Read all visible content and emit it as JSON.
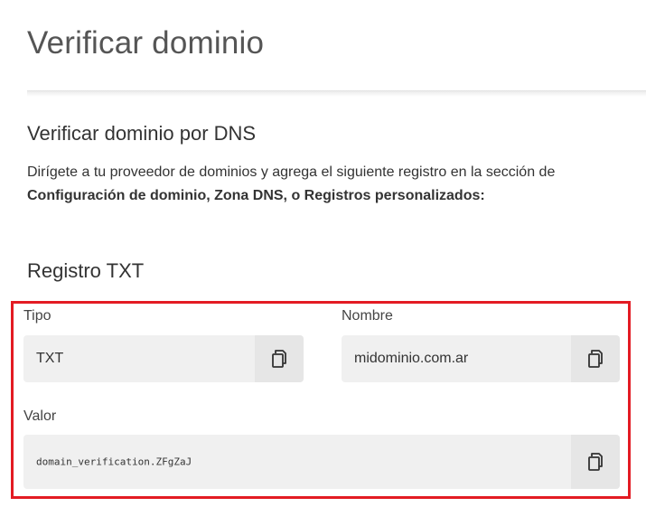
{
  "page": {
    "title": "Verificar dominio"
  },
  "dns_section": {
    "title": "Verificar dominio por DNS",
    "instructions_prefix": "Dirígete a tu proveedor de dominios y agrega el siguiente registro en la sección de ",
    "instructions_bold": "Configuración de dominio, Zona DNS, o Registros personalizados:"
  },
  "record": {
    "title": "Registro TXT",
    "highlight_color": "#e31b23",
    "fields": {
      "tipo": {
        "label": "Tipo",
        "value": "TXT"
      },
      "nombre": {
        "label": "Nombre",
        "value": "midominio.com.ar"
      },
      "valor": {
        "label": "Valor",
        "value": "domain_verification.ZFgZaJ"
      }
    },
    "copy_icon": "copy-icon"
  }
}
